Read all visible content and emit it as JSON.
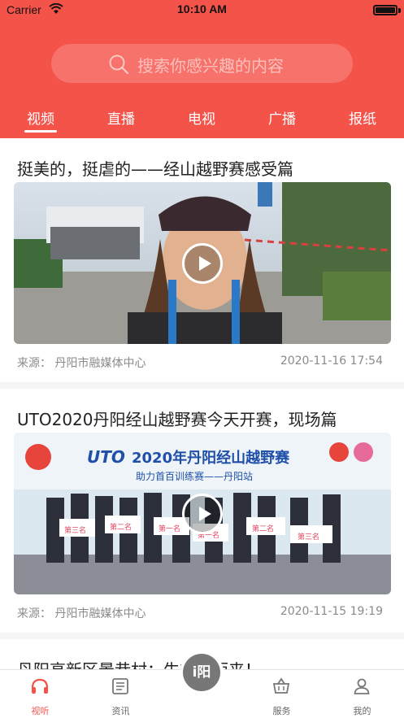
{
  "status_bar": {
    "carrier": "Carrier",
    "time": "10:10 AM"
  },
  "search": {
    "placeholder": "搜索你感兴趣的内容"
  },
  "tabs": [
    {
      "label": "视频",
      "active": true
    },
    {
      "label": "直播"
    },
    {
      "label": "电视"
    },
    {
      "label": "广播"
    },
    {
      "label": "报纸"
    }
  ],
  "feed": [
    {
      "title": "挺美的，挺虐的——经山越野赛感受篇",
      "source": "来源：  丹阳市融媒体中心",
      "date": "2020-11-16 17:54"
    },
    {
      "title": "UTO2020丹阳经山越野赛今天开赛，现场篇",
      "source": "来源：  丹阳市融媒体中心",
      "date": "2020-11-15 19:19",
      "banner": {
        "brand": "UTO",
        "headline": "2020年丹阳经山越野赛",
        "subline": "助力首百训练赛——丹阳站",
        "placards": [
          "第三名",
          "第二名",
          "第一名",
          "第一名",
          "第二名",
          "第三名"
        ]
      }
    },
    {
      "title": "丹阳高新区景巷村：生态好而来！"
    }
  ],
  "tabbar": {
    "items": [
      {
        "label": "视听",
        "icon": "listen-icon",
        "active": true
      },
      {
        "label": "资讯",
        "icon": "news-icon"
      },
      {
        "label": "i阳",
        "icon": "center-logo"
      },
      {
        "label": "服务",
        "icon": "basket-icon"
      },
      {
        "label": "我的",
        "icon": "person-icon"
      }
    ]
  },
  "colors": {
    "brand": "#f4534a",
    "active_tab": "#f4534a",
    "muted": "#8a8a8a"
  }
}
